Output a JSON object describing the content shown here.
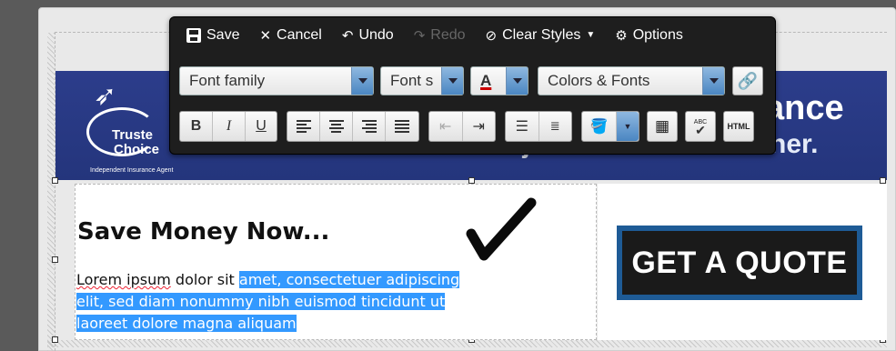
{
  "toolbar": {
    "save": "Save",
    "cancel": "Cancel",
    "undo": "Undo",
    "redo": "Redo",
    "clear_styles": "Clear Styles",
    "options": "Options",
    "font_family": "Font family",
    "font_size": "Font s",
    "colors_fonts": "Colors & Fonts",
    "bold": "B",
    "italic": "I",
    "underline": "U",
    "html": "HTML",
    "spell": "ABC"
  },
  "banner": {
    "logo_line1": "Truste",
    "logo_line2": "Choice",
    "logo_sub": "Independent Insurance Agent",
    "headline_part": "ance",
    "subline": "is just around the corner."
  },
  "content": {
    "heading": "Save Money Now...",
    "para_plain_1": "Lorem ipsum",
    "para_plain_2": " dolor sit ",
    "para_sel_1": "amet, consectetuer adipiscing",
    "para_sel_2": "elit, sed diam nonummy nibh euismod tincidunt ut",
    "para_sel_3": "laoreet dolore magna aliquam"
  },
  "cta": {
    "label": "GET A QUOTE"
  },
  "colors": {
    "banner": "#2c3d8b",
    "selection": "#3399ff",
    "cta_border": "#1e5b96",
    "toolbar": "#1e1e1e"
  }
}
